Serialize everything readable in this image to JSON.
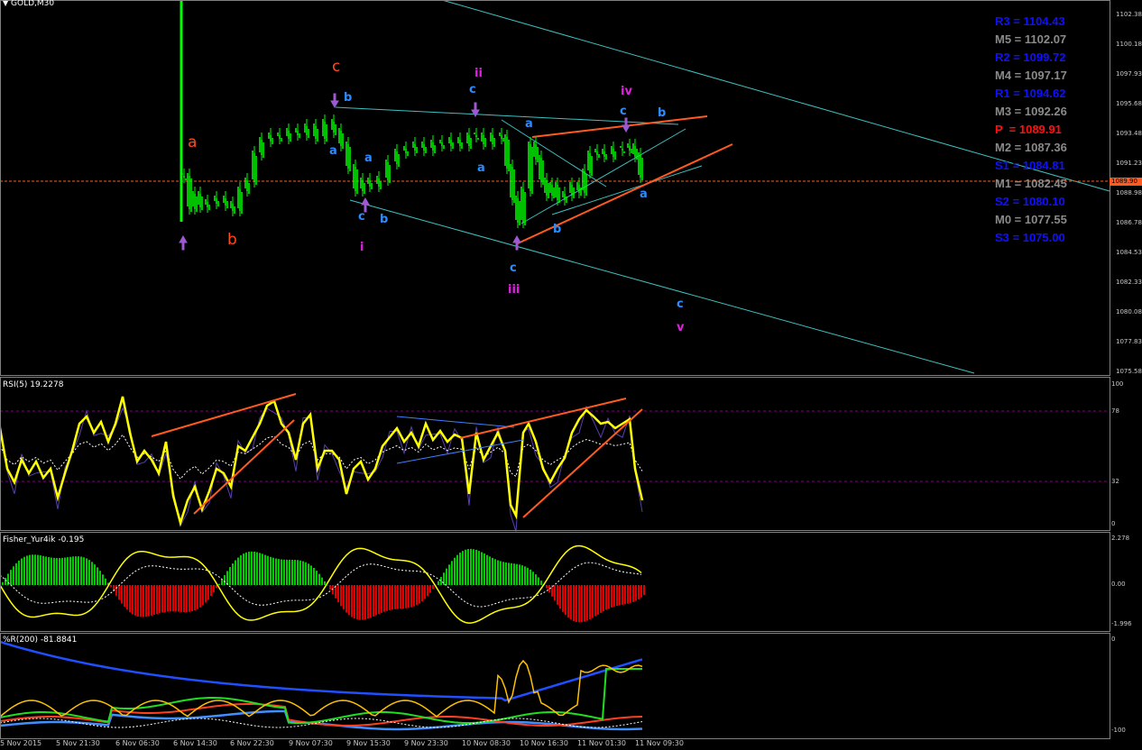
{
  "main_pane": {
    "symbol_title": "GOLD,M30",
    "price_ticks": [
      "1102.38",
      "1100.18",
      "1097.93",
      "1095.68",
      "1093.48",
      "1091.23",
      "1088.98",
      "1086.78",
      "1084.53",
      "1082.33",
      "1080.08",
      "1077.83",
      "1075.58"
    ],
    "current_price": "1089.90",
    "wave_labels": [
      {
        "text": "c",
        "color": "#ff4a1a",
        "big": true
      },
      {
        "text": "a",
        "color": "#ff4a1a",
        "big": true
      },
      {
        "text": "b",
        "color": "#ff4a1a",
        "big": true
      },
      {
        "text": "ii",
        "color": "#e020e0",
        "big": false
      },
      {
        "text": "iv",
        "color": "#e020e0",
        "big": false
      },
      {
        "text": "i",
        "color": "#e020e0",
        "big": false
      },
      {
        "text": "iii",
        "color": "#e020e0",
        "big": false
      },
      {
        "text": "v",
        "color": "#e020e0",
        "big": false
      },
      {
        "text": "b",
        "color": "#2c8cff",
        "big": false
      },
      {
        "text": "a",
        "color": "#2c8cff",
        "big": false
      },
      {
        "text": "a",
        "color": "#2c8cff",
        "big": false
      },
      {
        "text": "c",
        "color": "#2c8cff",
        "big": false
      },
      {
        "text": "b",
        "color": "#2c8cff",
        "big": false
      },
      {
        "text": "c",
        "color": "#2c8cff",
        "big": false
      },
      {
        "text": "a",
        "color": "#2c8cff",
        "big": false
      },
      {
        "text": "a",
        "color": "#2c8cff",
        "big": false
      },
      {
        "text": "c",
        "color": "#2c8cff",
        "big": false
      },
      {
        "text": "b",
        "color": "#2c8cff",
        "big": false
      },
      {
        "text": "b",
        "color": "#2c8cff",
        "big": false
      },
      {
        "text": "a",
        "color": "#2c8cff",
        "big": false
      },
      {
        "text": "c",
        "color": "#2c8cff",
        "big": false
      },
      {
        "text": "c",
        "color": "#2c8cff",
        "big": false
      }
    ],
    "pivots": [
      {
        "label": "R3 = 1104.43",
        "color": "#1010ff"
      },
      {
        "label": "M5 = 1102.07",
        "color": "#8a8a8a"
      },
      {
        "label": "R2 = 1099.72",
        "color": "#1010ff"
      },
      {
        "label": "M4 = 1097.17",
        "color": "#8a8a8a"
      },
      {
        "label": "R1 = 1094.62",
        "color": "#1010ff"
      },
      {
        "label": "M3 = 1092.26",
        "color": "#8a8a8a"
      },
      {
        "label": "P  = 1089.91",
        "color": "#ff1010"
      },
      {
        "label": "M2 = 1087.36",
        "color": "#8a8a8a"
      },
      {
        "label": "S1 = 1084.81",
        "color": "#1010ff"
      },
      {
        "label": "M1 = 1082.45",
        "color": "#8a8a8a"
      },
      {
        "label": "S2 = 1080.10",
        "color": "#1010ff"
      },
      {
        "label": "M0 = 1077.55",
        "color": "#8a8a8a"
      },
      {
        "label": "S3 = 1075.00",
        "color": "#1010ff"
      }
    ]
  },
  "rsi_pane": {
    "title": "RSI(5) 19.2278",
    "ticks": [
      "100",
      "78",
      "32",
      "0"
    ]
  },
  "fisher_pane": {
    "title": "Fisher_Yur4ik -0.195",
    "ticks": [
      "2.278",
      "0.00",
      "-1.996"
    ]
  },
  "wpr_pane": {
    "title": "%R(200) -81.8841",
    "ticks": [
      "0",
      "-100"
    ]
  },
  "time_axis": [
    "5 Nov 2015",
    "5 Nov 21:30",
    "6 Nov 06:30",
    "6 Nov 14:30",
    "6 Nov 22:30",
    "9 Nov 07:30",
    "9 Nov 15:30",
    "9 Nov 23:30",
    "10 Nov 08:30",
    "10 Nov 16:30",
    "11 Nov 01:30",
    "11 Nov 09:30"
  ],
  "colors": {
    "bull_candle": "#00ff00",
    "channel_line": "#3fbfbf",
    "trend_line": "#ff5a1f",
    "rsi_line": "#ffff00",
    "fisher_up": "#00cc00",
    "fisher_down": "#e00000",
    "wpr_fast": "#ffc000",
    "wpr_slow": "#1f4fff"
  }
}
